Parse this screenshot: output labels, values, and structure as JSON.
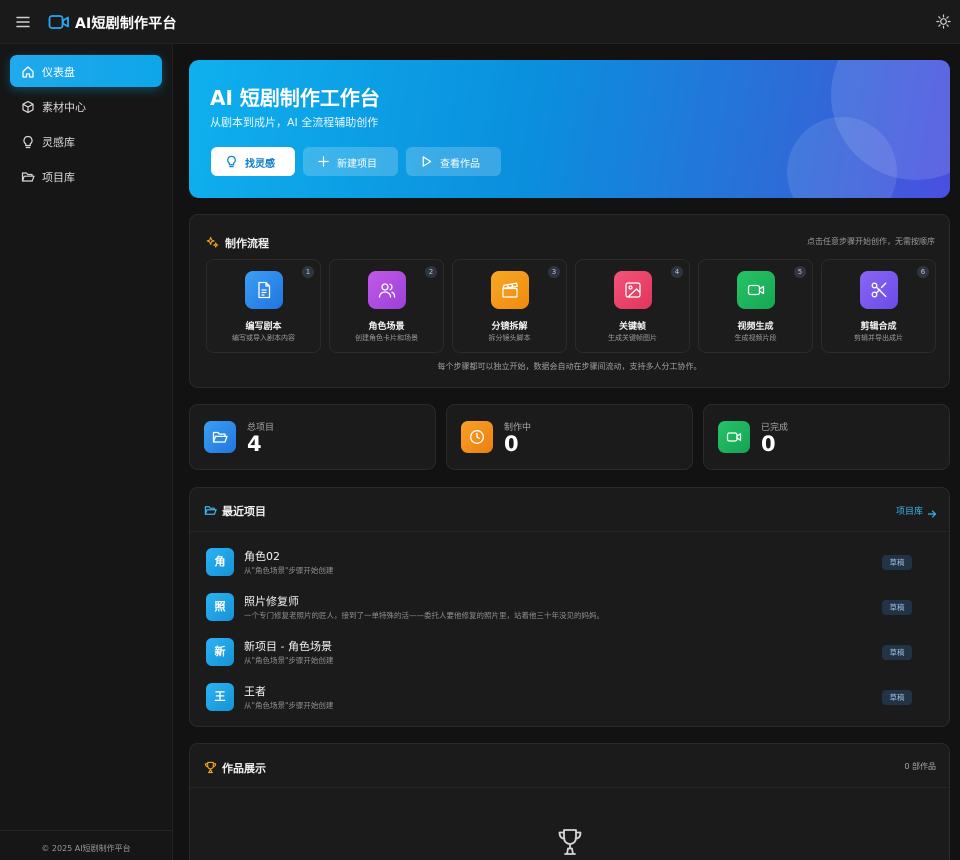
{
  "app": {
    "title": "AI短剧制作平台"
  },
  "sidebar": {
    "items": [
      {
        "label": "仪表盘",
        "icon": "home-icon",
        "active": true
      },
      {
        "label": "素材中心",
        "icon": "cube-icon",
        "active": false
      },
      {
        "label": "灵感库",
        "icon": "lightbulb-icon",
        "active": false
      },
      {
        "label": "项目库",
        "icon": "folder-open-icon",
        "active": false
      }
    ],
    "footer": "© 2025 AI短剧制作平台"
  },
  "hero": {
    "title": "AI 短剧制作工作台",
    "subtitle": "从剧本到成片，AI 全流程辅助创作",
    "buttons": [
      {
        "label": "找灵感",
        "icon": "lightbulb-icon"
      },
      {
        "label": "新建项目",
        "icon": "plus-icon"
      },
      {
        "label": "查看作品",
        "icon": "play-icon"
      }
    ]
  },
  "workflow": {
    "title": "制作流程",
    "hint": "点击任意步骤开始创作，无需按顺序",
    "steps": [
      {
        "num": "1",
        "name": "编写剧本",
        "desc": "编写或导入剧本内容",
        "icon": "document-icon",
        "color": "#2f8fef"
      },
      {
        "num": "2",
        "name": "角色场景",
        "desc": "创建角色卡片和场景",
        "icon": "users-icon",
        "color": "#b34fe0"
      },
      {
        "num": "3",
        "name": "分镜拆解",
        "desc": "拆分镜头脚本",
        "icon": "clapperboard-icon",
        "color": "#f59a12"
      },
      {
        "num": "4",
        "name": "关键帧",
        "desc": "生成关键帧图片",
        "icon": "image-icon",
        "color": "#ec4468"
      },
      {
        "num": "5",
        "name": "视频生成",
        "desc": "生成视频片段",
        "icon": "video-icon",
        "color": "#20b95e"
      },
      {
        "num": "6",
        "name": "剪辑合成",
        "desc": "剪辑并导出成片",
        "icon": "scissors-icon",
        "color": "#7a5cf0"
      }
    ],
    "note": "每个步骤都可以独立开始，数据会自动在步骤间流动，支持多人分工协作。"
  },
  "stats": [
    {
      "label": "总项目",
      "value": "4",
      "icon": "folder-open-icon",
      "color": "#2d8fe8"
    },
    {
      "label": "制作中",
      "value": "0",
      "icon": "clock-icon",
      "color": "#f28a12"
    },
    {
      "label": "已完成",
      "value": "0",
      "icon": "video-icon",
      "color": "#1fb35a"
    }
  ],
  "recent": {
    "title": "最近项目",
    "link": "项目库",
    "projects": [
      {
        "avatar": "角",
        "name": "角色02",
        "desc": "从\"角色场景\"步骤开始创建",
        "status": "草稿"
      },
      {
        "avatar": "照",
        "name": "照片修复师",
        "desc": "一个专门修复老照片的匠人，接到了一单特殊的活——委托人要他修复的照片里，站着他三十年没见的妈妈。",
        "status": "草稿"
      },
      {
        "avatar": "新",
        "name": "新项目 - 角色场景",
        "desc": "从\"角色场景\"步骤开始创建",
        "status": "草稿"
      },
      {
        "avatar": "王",
        "name": "王者",
        "desc": "从\"角色场景\"步骤开始创建",
        "status": "草稿"
      }
    ]
  },
  "works": {
    "title": "作品展示",
    "count": "0 部作品"
  }
}
